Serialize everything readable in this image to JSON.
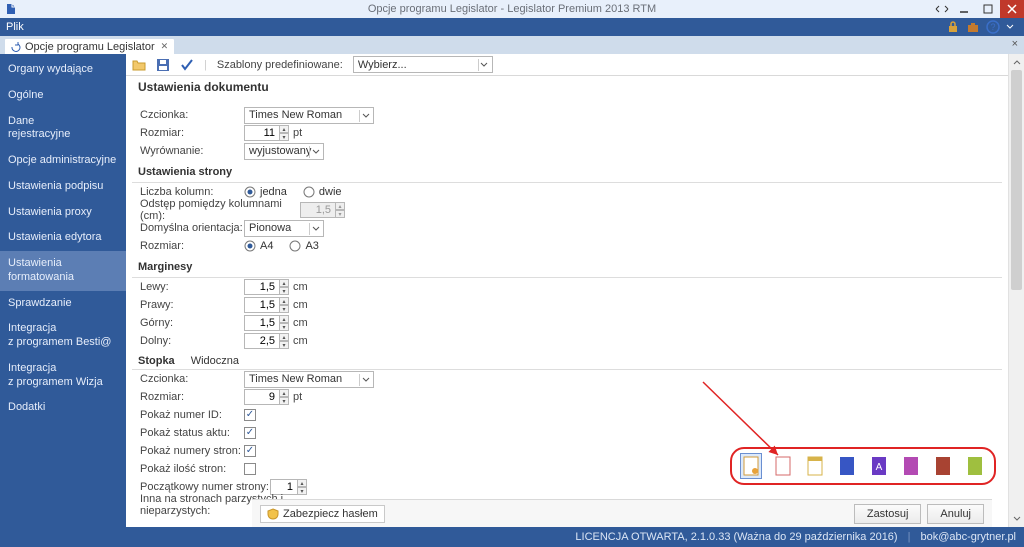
{
  "titlebar": {
    "title": "Opcje programu Legislator - Legislator Premium 2013 RTM"
  },
  "menubar": {
    "file": "Plik"
  },
  "tab": {
    "label": "Opcje programu Legislator"
  },
  "sidebar": {
    "items": [
      "Organy wydające",
      "Ogólne",
      "Dane\nrejestracyjne",
      "Opcje administracyjne",
      "Ustawienia podpisu",
      "Ustawienia proxy",
      "Ustawienia edytora",
      "Ustawienia formatowania",
      "Sprawdzanie",
      "Integracja\nz programem Besti@",
      "Integracja\nz programem Wizja",
      "Dodatki"
    ],
    "active_index": 7
  },
  "toolbar": {
    "templates_label": "Szablony predefiniowane:",
    "templates_value": "Wybierz..."
  },
  "doc": {
    "section_title": "Ustawienia dokumentu",
    "font_label": "Czcionka:",
    "font_value": "Times New Roman",
    "size_label": "Rozmiar:",
    "size_value": "11",
    "size_unit": "pt",
    "align_label": "Wyrównanie:",
    "align_value": "wyjustowany"
  },
  "page": {
    "section_title": "Ustawienia strony",
    "cols_label": "Liczba kolumn:",
    "col_one": "jedna",
    "col_two": "dwie",
    "colgap_label": "Odstęp pomiędzy kolumnami (cm):",
    "colgap_value": "1,5",
    "orient_label": "Domyślna orientacja:",
    "orient_value": "Pionowa",
    "size_label": "Rozmiar:",
    "size_a4": "A4",
    "size_a3": "A3"
  },
  "margins": {
    "section_title": "Marginesy",
    "left_label": "Lewy:",
    "left_value": "1,5",
    "right_label": "Prawy:",
    "right_value": "1,5",
    "top_label": "Górny:",
    "top_value": "1,5",
    "bottom_label": "Dolny:",
    "bottom_value": "2,5",
    "unit": "cm"
  },
  "footer": {
    "section_title": "Stopka",
    "visible_label": "Widoczna",
    "font_label": "Czcionka:",
    "font_value": "Times New Roman",
    "size_label": "Rozmiar:",
    "size_value": "9",
    "size_unit": "pt",
    "show_id_label": "Pokaż numer ID:",
    "show_status_label": "Pokaż status aktu:",
    "show_pages_label": "Pokaż numery stron:",
    "show_count_label": "Pokaż ilość stron:",
    "start_page_label": "Początkowy numer strony:",
    "start_page_value": "1",
    "alt_pages_label": "Inna na stronach parzystych i nieparzystych:"
  },
  "buttons": {
    "secure": "Zabezpiecz hasłem",
    "apply": "Zastosuj",
    "cancel": "Anuluj"
  },
  "status": {
    "license": "LICENCJA OTWARTA, 2.1.0.33 (Ważna do 29 października 2016)",
    "email": "bok@abc-grytner.pl"
  }
}
